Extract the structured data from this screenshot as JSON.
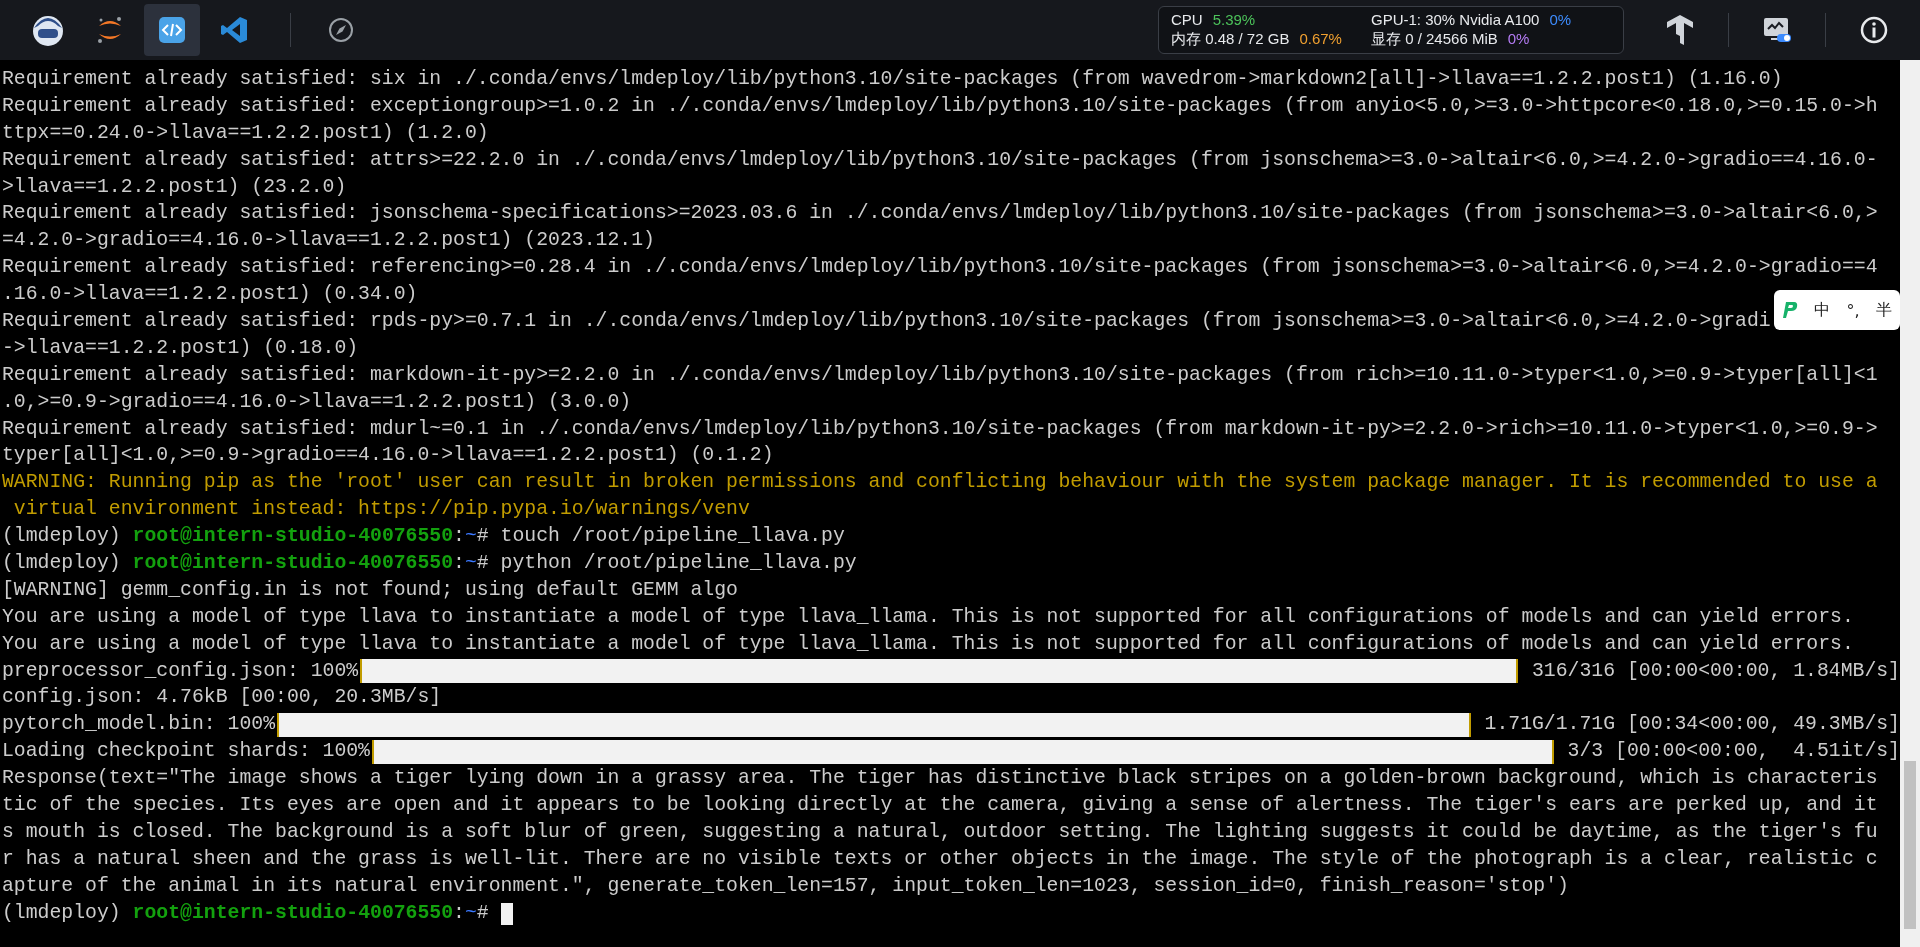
{
  "toolbar": {
    "apps": [
      {
        "kind": "avatar",
        "selected": false
      },
      {
        "kind": "orbit",
        "selected": false
      },
      {
        "kind": "code",
        "selected": true
      },
      {
        "kind": "ribbon",
        "selected": false
      },
      {
        "kind": "compass",
        "selected": false
      }
    ],
    "stats": [
      {
        "label": "CPU",
        "value": "5.39%",
        "color": "#4cc25a"
      },
      {
        "label": "GPU-1: 30% Nvidia A100",
        "value": "0%",
        "color": "#3d8bfd"
      },
      {
        "label": "内存 0.48 / 72 GB",
        "value": "0.67%",
        "color": "#f0a030"
      },
      {
        "label": "显存 0 / 24566 MiB",
        "value": "0%",
        "color": "#b57cf5"
      }
    ],
    "tools": [
      {
        "kind": "cube"
      },
      {
        "kind": "monitor"
      },
      {
        "kind": "info"
      }
    ]
  },
  "terminal": {
    "lines": [
      {
        "kind": "text",
        "text": "Requirement already satisfied: six in ./.conda/envs/lmdeploy/lib/python3.10/site-packages (from wavedrom->markdown2[all]->llava==1.2.2.post1) (1.16.0)"
      },
      {
        "kind": "text",
        "text": "Requirement already satisfied: exceptiongroup>=1.0.2 in ./.conda/envs/lmdeploy/lib/python3.10/site-packages (from anyio<5.0,>=3.0->httpcore<0.18.0,>=0.15.0->h"
      },
      {
        "kind": "text",
        "text": "ttpx==0.24.0->llava==1.2.2.post1) (1.2.0)"
      },
      {
        "kind": "text",
        "text": "Requirement already satisfied: attrs>=22.2.0 in ./.conda/envs/lmdeploy/lib/python3.10/site-packages (from jsonschema>=3.0->altair<6.0,>=4.2.0->gradio==4.16.0-"
      },
      {
        "kind": "text",
        "text": ">llava==1.2.2.post1) (23.2.0)"
      },
      {
        "kind": "text",
        "text": "Requirement already satisfied: jsonschema-specifications>=2023.03.6 in ./.conda/envs/lmdeploy/lib/python3.10/site-packages (from jsonschema>=3.0->altair<6.0,>"
      },
      {
        "kind": "text",
        "text": "=4.2.0->gradio==4.16.0->llava==1.2.2.post1) (2023.12.1)"
      },
      {
        "kind": "text",
        "text": "Requirement already satisfied: referencing>=0.28.4 in ./.conda/envs/lmdeploy/lib/python3.10/site-packages (from jsonschema>=3.0->altair<6.0,>=4.2.0->gradio==4"
      },
      {
        "kind": "text",
        "text": ".16.0->llava==1.2.2.post1) (0.34.0)"
      },
      {
        "kind": "text",
        "text": "Requirement already satisfied: rpds-py>=0.7.1 in ./.conda/envs/lmdeploy/lib/python3.10/site-packages (from jsonschema>=3.0->altair<6.0,>=4.2.0->gradi"
      },
      {
        "kind": "text",
        "text": "->llava==1.2.2.post1) (0.18.0)"
      },
      {
        "kind": "text",
        "text": "Requirement already satisfied: markdown-it-py>=2.2.0 in ./.conda/envs/lmdeploy/lib/python3.10/site-packages (from rich>=10.11.0->typer<1.0,>=0.9->typer[all]<1"
      },
      {
        "kind": "text",
        "text": ".0,>=0.9->gradio==4.16.0->llava==1.2.2.post1) (3.0.0)"
      },
      {
        "kind": "text",
        "text": "Requirement already satisfied: mdurl~=0.1 in ./.conda/envs/lmdeploy/lib/python3.10/site-packages (from markdown-it-py>=2.2.0->rich>=10.11.0->typer<1.0,>=0.9->"
      },
      {
        "kind": "text",
        "text": "typer[all]<1.0,>=0.9->gradio==4.16.0->llava==1.2.2.post1) (0.1.2)"
      },
      {
        "kind": "warning",
        "text": "WARNING: Running pip as the 'root' user can result in broken permissions and conflicting behaviour with the system package manager. It is recommended to use a"
      },
      {
        "kind": "warning",
        "text": " virtual environment instead: https://pip.pypa.io/warnings/venv"
      },
      {
        "kind": "prompt",
        "env": "(lmdeploy)",
        "user": "root@intern-studio-40076550",
        "sep": ":",
        "path": "~",
        "sign": "#",
        "command": "touch /root/pipeline_llava.py",
        "cursor": false
      },
      {
        "kind": "prompt",
        "env": "(lmdeploy)",
        "user": "root@intern-studio-40076550",
        "sep": ":",
        "path": "~",
        "sign": "#",
        "command": "python /root/pipeline_llava.py",
        "cursor": false
      },
      {
        "kind": "text",
        "text": "[WARNING] gemm_config.in is not found; using default GEMM algo"
      },
      {
        "kind": "text",
        "text": "You are using a model of type llava to instantiate a model of type llava_llama. This is not supported for all configurations of models and can yield errors."
      },
      {
        "kind": "text",
        "text": "You are using a model of type llava to instantiate a model of type llava_llama. This is not supported for all configurations of models and can yield errors."
      },
      {
        "kind": "progress",
        "label": "preprocessor_config.json: 100%",
        "level": 1,
        "stats": "316/316 [00:00<00:00, 1.84MB/s]"
      },
      {
        "kind": "text",
        "text": "config.json: 4.76kB [00:00, 20.3MB/s]"
      },
      {
        "kind": "progress",
        "label": "pytorch_model.bin: 100%",
        "level": 1,
        "stats": "1.71G/1.71G [00:34<00:00, 49.3MB/s]"
      },
      {
        "kind": "progress",
        "label": "Loading checkpoint shards: 100%",
        "level": 1,
        "stats": "3/3 [00:00<00:00,  4.51it/s]"
      },
      {
        "kind": "text",
        "text": "Response(text=\"The image shows a tiger lying down in a grassy area. The tiger has distinctive black stripes on a golden-brown background, which is characteris"
      },
      {
        "kind": "text",
        "text": "tic of the species. Its eyes are open and it appears to be looking directly at the camera, giving a sense of alertness. The tiger's ears are perked up, and it"
      },
      {
        "kind": "text",
        "text": "s mouth is closed. The background is a soft blur of green, suggesting a natural, outdoor setting. The lighting suggests it could be daytime, as the tiger's fu"
      },
      {
        "kind": "text",
        "text": "r has a natural sheen and the grass is well-lit. There are no visible texts or other objects in the image. The style of the photograph is a clear, realistic c"
      },
      {
        "kind": "text",
        "text": "apture of the animal in its natural environment.\", generate_token_len=157, input_token_len=1023, session_id=0, finish_reason='stop')"
      },
      {
        "kind": "prompt",
        "env": "(lmdeploy)",
        "user": "root@intern-studio-40076550",
        "sep": ":",
        "path": "~",
        "sign": "#",
        "cursor": true
      }
    ]
  },
  "ime": {
    "items": [
      "中",
      "°,",
      "半"
    ]
  }
}
